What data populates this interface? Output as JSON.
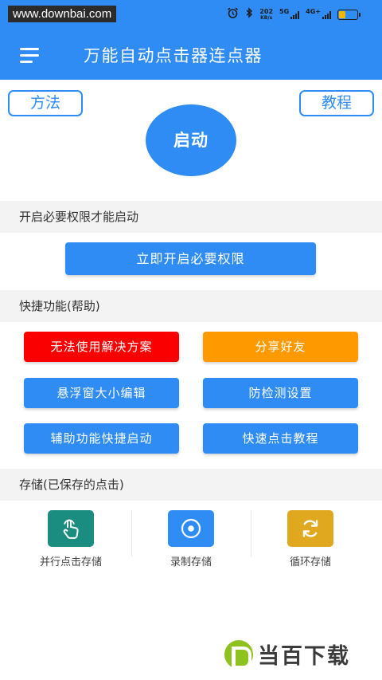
{
  "status_bar": {
    "watermark": "www.downbai.com",
    "net_speed_value": "202",
    "net_speed_unit": "KB/s",
    "network_5g": "5G",
    "network_4g": "4G+",
    "battery_level": 0.35,
    "icons": [
      "alarm-icon",
      "bluetooth-icon",
      "signal-icon",
      "battery-icon"
    ]
  },
  "app_bar": {
    "title": "万能自动点击器连点器",
    "menu_icon": "menu-icon"
  },
  "top_buttons": {
    "method": "方法",
    "tutorial": "教程"
  },
  "start_button": "启动",
  "permission_section": {
    "header": "开启必要权限才能启动",
    "button": "立即开启必要权限"
  },
  "quick_section": {
    "header": "快捷功能(帮助)",
    "buttons": [
      "无法使用解决方案",
      "分享好友",
      "悬浮窗大小编辑",
      "防检测设置",
      "辅助功能快捷启动",
      "快速点击教程"
    ]
  },
  "storage_section": {
    "header": "存储(已保存的点击)",
    "items": [
      {
        "label": "并行点击存储",
        "icon": "hand-tap-icon",
        "color": "#1a8c80"
      },
      {
        "label": "录制存储",
        "icon": "record-eye-icon",
        "color": "#2f8cf5"
      },
      {
        "label": "循环存储",
        "icon": "loop-icon",
        "color": "#e0a81e"
      }
    ]
  },
  "brand_logo_text": "当百下载",
  "colors": {
    "primary": "#2f8cf5",
    "danger": "#fb0000",
    "warning": "#fe9a00",
    "section_bg": "#f3f3f3"
  }
}
